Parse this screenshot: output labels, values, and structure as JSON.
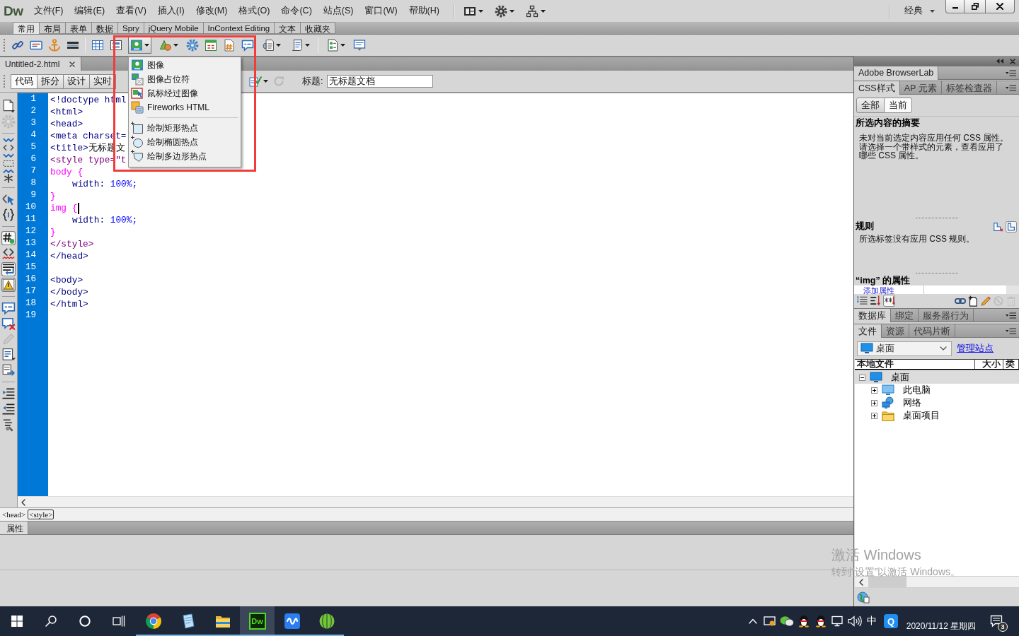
{
  "app": {
    "logo": "Dw"
  },
  "menu_bar": {
    "items": [
      "文件(F)",
      "编辑(E)",
      "查看(V)",
      "插入(I)",
      "修改(M)",
      "格式(O)",
      "命令(C)",
      "站点(S)",
      "窗口(W)",
      "帮助(H)"
    ],
    "workspace": "经典"
  },
  "insert_panel": {
    "tabs": [
      {
        "label": "常用",
        "selected": true
      },
      {
        "label": "布局",
        "selected": false
      },
      {
        "label": "表单",
        "selected": false
      },
      {
        "label": "数据",
        "selected": false
      },
      {
        "label": "Spry",
        "selected": false
      },
      {
        "label": "jQuery Mobile",
        "selected": false
      },
      {
        "label": "InContext Editing",
        "selected": false
      },
      {
        "label": "文本",
        "selected": false
      },
      {
        "label": "收藏夹",
        "selected": false
      }
    ],
    "tools": [
      {
        "kind": "hyperlink",
        "dropdown": false,
        "open": false
      },
      {
        "kind": "email",
        "dropdown": false,
        "open": false
      },
      {
        "kind": "anchor",
        "dropdown": false,
        "open": false
      },
      {
        "kind": "rule",
        "dropdown": false,
        "open": false
      },
      {
        "kind": "separator"
      },
      {
        "kind": "table",
        "dropdown": false,
        "open": false
      },
      {
        "kind": "div",
        "dropdown": false,
        "open": false
      },
      {
        "kind": "image",
        "dropdown": true,
        "open": true
      },
      {
        "kind": "media",
        "dropdown": true,
        "open": false
      },
      {
        "kind": "widget",
        "dropdown": false,
        "open": false
      },
      {
        "kind": "date",
        "dropdown": false,
        "open": false
      },
      {
        "kind": "include",
        "dropdown": false,
        "open": false
      },
      {
        "kind": "comment",
        "dropdown": false,
        "open": false
      },
      {
        "kind": "head",
        "dropdown": true,
        "open": false
      },
      {
        "kind": "script",
        "dropdown": true,
        "open": false
      },
      {
        "kind": "separator"
      },
      {
        "kind": "template",
        "dropdown": true,
        "open": false
      },
      {
        "kind": "tagchooser",
        "dropdown": false,
        "open": false
      }
    ]
  },
  "insert_menu": {
    "items": [
      {
        "kind": "image",
        "label": "图像"
      },
      {
        "kind": "placeholder",
        "label": "图像占位符"
      },
      {
        "kind": "rollover",
        "label": "鼠标经过图像"
      },
      {
        "kind": "fireworks",
        "label": "Fireworks HTML"
      },
      {
        "kind": "separator"
      },
      {
        "kind": "rect_hotspot",
        "label": "绘制矩形热点"
      },
      {
        "kind": "oval_hotspot",
        "label": "绘制椭圆热点"
      },
      {
        "kind": "polygon_hotspot",
        "label": "绘制多边形热点"
      }
    ]
  },
  "highlight_frame": true,
  "document": {
    "tab": "Untitled-2.html",
    "views": [
      {
        "label": "代码",
        "selected": true
      },
      {
        "label": "拆分",
        "selected": false
      },
      {
        "label": "设计",
        "selected": false
      },
      {
        "label": "实时",
        "selected": false
      }
    ],
    "tools": [
      {
        "kind": "validate",
        "dropdown": true,
        "disabled": false
      },
      {
        "kind": "refresh",
        "dropdown": false,
        "disabled": true
      }
    ],
    "title_label": "标题:",
    "title_value": "无标题文档"
  },
  "coding_toolbar": [
    {
      "kind": "documents",
      "pressed": false,
      "disabled": false
    },
    {
      "kind": "navigator",
      "pressed": false,
      "disabled": true
    },
    {
      "kind": "separator"
    },
    {
      "kind": "collapse_tag",
      "pressed": false,
      "disabled": false
    },
    {
      "kind": "collapse_selection",
      "pressed": false,
      "disabled": false
    },
    {
      "kind": "expand_all",
      "pressed": false,
      "disabled": false
    },
    {
      "kind": "separator"
    },
    {
      "kind": "select_parent",
      "pressed": false,
      "disabled": false
    },
    {
      "kind": "balance",
      "pressed": false,
      "disabled": false
    },
    {
      "kind": "separator"
    },
    {
      "kind": "line_numbers",
      "pressed": true,
      "disabled": false
    },
    {
      "kind": "invalid",
      "pressed": false,
      "disabled": false
    },
    {
      "kind": "word_wrap",
      "pressed": true,
      "disabled": false
    },
    {
      "kind": "syntax",
      "pressed": true,
      "disabled": false
    },
    {
      "kind": "separator"
    },
    {
      "kind": "comment",
      "pressed": false,
      "disabled": false
    },
    {
      "kind": "uncomment",
      "pressed": false,
      "disabled": false
    },
    {
      "kind": "wrap_tag",
      "pressed": false,
      "disabled": true
    },
    {
      "kind": "snippets",
      "pressed": false,
      "disabled": false
    },
    {
      "kind": "move_css",
      "pressed": false,
      "disabled": false
    },
    {
      "kind": "separator"
    },
    {
      "kind": "indent",
      "pressed": false,
      "disabled": false
    },
    {
      "kind": "outdent",
      "pressed": false,
      "disabled": false
    },
    {
      "kind": "format",
      "pressed": false,
      "disabled": false
    }
  ],
  "editor": {
    "lines": [
      {
        "number": "1",
        "indent": false,
        "caret": false,
        "tokens": [
          {
            "kind": "tag",
            "text": "<!doctype html"
          }
        ]
      },
      {
        "number": "2",
        "indent": false,
        "caret": false,
        "tokens": [
          {
            "kind": "tag",
            "text": "<html>"
          }
        ]
      },
      {
        "number": "3",
        "indent": false,
        "caret": false,
        "tokens": [
          {
            "kind": "tag",
            "text": "<head>"
          }
        ]
      },
      {
        "number": "4",
        "indent": false,
        "caret": false,
        "tokens": [
          {
            "kind": "tag",
            "text": "<meta charset="
          }
        ]
      },
      {
        "number": "5",
        "indent": false,
        "caret": false,
        "tokens": [
          {
            "kind": "tag",
            "text": "<title>"
          },
          {
            "kind": "text",
            "text": "无标题文"
          }
        ]
      },
      {
        "number": "6",
        "indent": false,
        "caret": false,
        "tokens": [
          {
            "kind": "style_tag",
            "text": "<style type=\"t"
          }
        ]
      },
      {
        "number": "7",
        "indent": false,
        "caret": false,
        "tokens": [
          {
            "kind": "selector",
            "text": "body {"
          }
        ]
      },
      {
        "number": "8",
        "indent": true,
        "caret": false,
        "tokens": [
          {
            "kind": "property",
            "text": "width:"
          },
          {
            "kind": "value",
            "text": " 100%;"
          }
        ]
      },
      {
        "number": "9",
        "indent": false,
        "caret": false,
        "tokens": [
          {
            "kind": "selector",
            "text": "}"
          }
        ]
      },
      {
        "number": "10",
        "indent": false,
        "caret": true,
        "tokens": [
          {
            "kind": "selector",
            "text": "img {"
          }
        ]
      },
      {
        "number": "11",
        "indent": true,
        "caret": false,
        "tokens": [
          {
            "kind": "property",
            "text": "width:"
          },
          {
            "kind": "value",
            "text": " 100%;"
          }
        ]
      },
      {
        "number": "12",
        "indent": false,
        "caret": false,
        "tokens": [
          {
            "kind": "selector",
            "text": "}"
          }
        ]
      },
      {
        "number": "13",
        "indent": false,
        "caret": false,
        "tokens": [
          {
            "kind": "style_tag",
            "text": "</style>"
          }
        ]
      },
      {
        "number": "14",
        "indent": false,
        "caret": false,
        "tokens": [
          {
            "kind": "tag",
            "text": "</head>"
          }
        ]
      },
      {
        "number": "15",
        "caret": false
      },
      {
        "number": "16",
        "indent": false,
        "caret": false,
        "tokens": [
          {
            "kind": "tag",
            "text": "<body>"
          }
        ]
      },
      {
        "number": "17",
        "indent": false,
        "caret": false,
        "tokens": [
          {
            "kind": "tag",
            "text": "</body>"
          }
        ]
      },
      {
        "number": "18",
        "indent": false,
        "caret": false,
        "tokens": [
          {
            "kind": "tag",
            "text": "</html>"
          }
        ]
      },
      {
        "number": "19",
        "caret": false
      }
    ]
  },
  "tag_selector": {
    "tags": [
      {
        "label": "<head>",
        "selected": false
      },
      {
        "label": "<style>",
        "selected": true
      }
    ]
  },
  "properties_panel": {
    "title": "属性"
  },
  "right_panel": {
    "browserlab_tabs": [
      {
        "label": "Adobe BrowserLab",
        "selected": true
      }
    ],
    "css_tabs": [
      {
        "label": "CSS样式",
        "selected": true
      },
      {
        "label": "AP 元素",
        "selected": false
      },
      {
        "label": "标签检查器",
        "selected": false
      }
    ],
    "css_modes": [
      {
        "label": "全部",
        "selected": false
      },
      {
        "label": "当前",
        "selected": true
      }
    ],
    "summary_title": "所选内容的摘要",
    "summary_text": "未对当前选定内容应用任何 CSS 属性。请选择一个带样式的元素，查看应用了哪些 CSS 属性。",
    "rules_title": "规则",
    "rule_views": [
      {
        "kind": "cascade",
        "selected": false
      },
      {
        "kind": "info",
        "selected": true
      }
    ],
    "rules_text": "所选标签没有应用 CSS 规则。",
    "properties_title": "“img” 的属性",
    "add_property": "添加属性",
    "view_buttons": [
      {
        "kind": "category",
        "selected": false
      },
      {
        "kind": "alphabetical",
        "selected": false
      },
      {
        "kind": "set_only",
        "selected": true
      }
    ],
    "actions": [
      {
        "kind": "attach",
        "disabled": false
      },
      {
        "kind": "new_rule",
        "disabled": false
      },
      {
        "kind": "edit",
        "disabled": false
      },
      {
        "kind": "disable",
        "disabled": true
      },
      {
        "kind": "delete",
        "disabled": true
      }
    ],
    "database_tabs": [
      {
        "label": "数据库",
        "selected": true
      },
      {
        "label": "绑定",
        "selected": false
      },
      {
        "label": "服务器行为",
        "selected": false
      }
    ],
    "files_tabs": [
      {
        "label": "文件",
        "selected": true
      },
      {
        "label": "资源",
        "selected": false
      },
      {
        "label": "代码片断",
        "selected": false
      }
    ],
    "site": "桌面",
    "manage_link": "管理站点",
    "columns": [
      "本地文件",
      "大小",
      "类"
    ],
    "tree": [
      {
        "kind": "desktop",
        "label": "桌面",
        "expanded": true,
        "selected": true,
        "children": [
          {
            "kind": "computer",
            "label": "此电脑",
            "expanded": false,
            "selected": false
          },
          {
            "kind": "network",
            "label": "网络",
            "expanded": false,
            "selected": false
          },
          {
            "kind": "folder",
            "label": "桌面项目",
            "expanded": false,
            "selected": false
          }
        ]
      }
    ]
  },
  "activation": {
    "title": "激活 Windows",
    "subtitle": "转到“设置”以激活 Windows。"
  },
  "taskbar": {
    "apps": [
      {
        "kind": "chrome",
        "running": true,
        "active": false
      },
      {
        "kind": "notes",
        "running": true,
        "active": false
      },
      {
        "kind": "explorer",
        "running": true,
        "active": false
      },
      {
        "kind": "dreamweaver",
        "label": "Dw",
        "running": true,
        "active": true
      },
      {
        "kind": "wps",
        "running": true,
        "active": false
      },
      {
        "kind": "ball",
        "running": true,
        "active": false
      }
    ],
    "ime": "中",
    "tray_app": "Q",
    "date": "2020/11/12 星期四",
    "notifications": "3"
  }
}
